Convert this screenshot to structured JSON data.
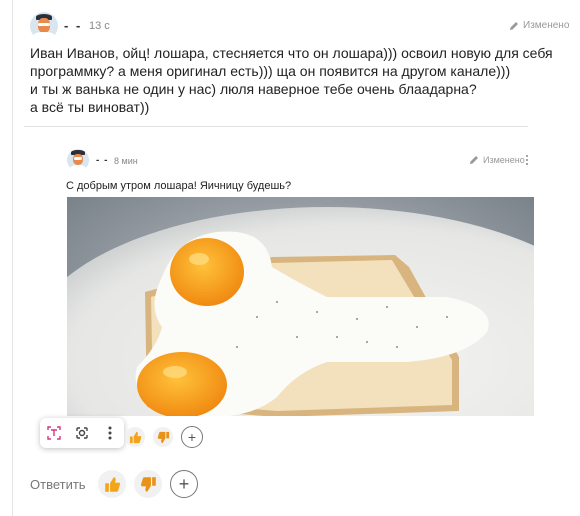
{
  "comment": {
    "author": "- -",
    "time": "13 с",
    "edited_label": "Изменено",
    "text_lines": [
      "Иван Иванов, ойц! лошара, стесняется что он лошара))) освоил новую для себя",
      "программку? а меня оригинал есть))) ща он появится на другом канале)))",
      "и ты ж ванька не один у нас) люля наверное тебе очень блаадарна?",
      "а всё ты виноват))"
    ]
  },
  "quoted": {
    "author": "- -",
    "time": "8 мин",
    "edited_label": "Изменено",
    "text": "С добрым утром лошара! Яичницу будешь?"
  },
  "actions": {
    "reply_label": "Ответить",
    "icons": [
      "thumbs-up-icon",
      "thumbs-down-icon",
      "plus-icon",
      "text-select-icon",
      "lens-icon",
      "more-vertical-icon"
    ]
  },
  "colors": {
    "thumb_up": "#f2a51a",
    "thumb_down": "#e8921a",
    "accent_pink": "#d6338a"
  }
}
